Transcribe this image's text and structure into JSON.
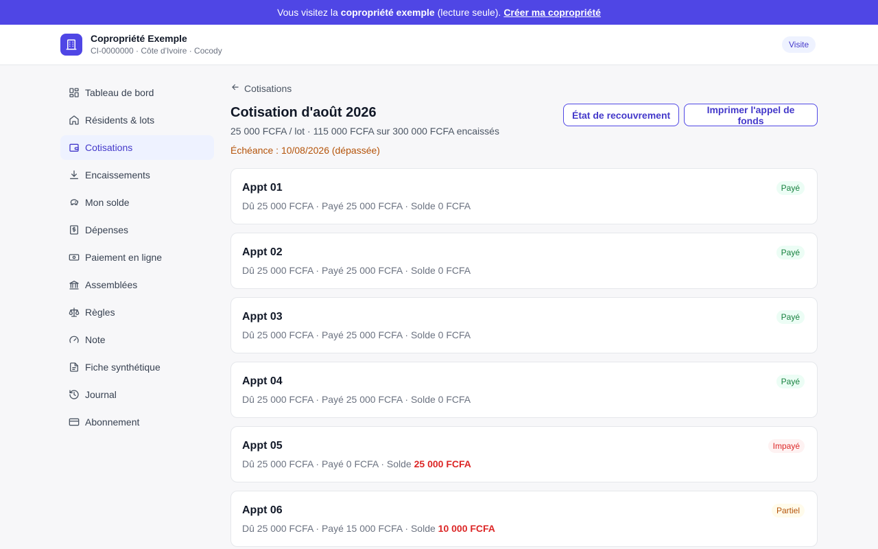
{
  "banner": {
    "prefix": "Vous visitez la",
    "highlight": "copropriété exemple",
    "suffix": "(lecture seule).",
    "cta": "Créer ma copropriété",
    "color": "#4f46e5"
  },
  "header": {
    "org_name": "Copropriété Exemple",
    "org_sub": "CI-0000000 · Côte d'Ivoire · Cocody",
    "badge": "Visite",
    "logo_icon": "building-icon"
  },
  "sidebar": {
    "items": [
      {
        "label": "Tableau de bord",
        "icon": "dashboard-icon",
        "active": false
      },
      {
        "label": "Résidents & lots",
        "icon": "home-icon",
        "active": false
      },
      {
        "label": "Cotisations",
        "icon": "wallet-icon",
        "active": true
      },
      {
        "label": "Encaissements",
        "icon": "download-icon",
        "active": false
      },
      {
        "label": "Mon solde",
        "icon": "piggy-bank-icon",
        "active": false
      },
      {
        "label": "Dépenses",
        "icon": "receipt-icon",
        "active": false
      },
      {
        "label": "Paiement en ligne",
        "icon": "banknote-icon",
        "active": false
      },
      {
        "label": "Assemblées",
        "icon": "landmark-icon",
        "active": false
      },
      {
        "label": "Règles",
        "icon": "scale-icon",
        "active": false
      },
      {
        "label": "Note",
        "icon": "gauge-icon",
        "active": false
      },
      {
        "label": "Fiche synthétique",
        "icon": "file-text-icon",
        "active": false
      },
      {
        "label": "Journal",
        "icon": "history-icon",
        "active": false
      },
      {
        "label": "Abonnement",
        "icon": "credit-card-icon",
        "active": false
      }
    ]
  },
  "main": {
    "back_label": "Cotisations",
    "title": "Cotisation d'août 2026",
    "subtitle": "25 000 FCFA / lot · 115 000 FCFA sur 300 000 FCFA encaissés",
    "due": "Échéance : 10/08/2026 (dépassée)",
    "buttons": {
      "recovery": "État de recouvrement",
      "print": "Imprimer l'appel de fonds"
    }
  },
  "lots": [
    {
      "name": "Appt 01",
      "due_text": "Dû 25 000 FCFA",
      "paid_text": "Payé 25 000 FCFA",
      "balance_label": "Solde",
      "balance": "0 FCFA",
      "owed": false,
      "status": "Payé",
      "status_kind": "paid"
    },
    {
      "name": "Appt 02",
      "due_text": "Dû 25 000 FCFA",
      "paid_text": "Payé 25 000 FCFA",
      "balance_label": "Solde",
      "balance": "0 FCFA",
      "owed": false,
      "status": "Payé",
      "status_kind": "paid"
    },
    {
      "name": "Appt 03",
      "due_text": "Dû 25 000 FCFA",
      "paid_text": "Payé 25 000 FCFA",
      "balance_label": "Solde",
      "balance": "0 FCFA",
      "owed": false,
      "status": "Payé",
      "status_kind": "paid"
    },
    {
      "name": "Appt 04",
      "due_text": "Dû 25 000 FCFA",
      "paid_text": "Payé 25 000 FCFA",
      "balance_label": "Solde",
      "balance": "0 FCFA",
      "owed": false,
      "status": "Payé",
      "status_kind": "paid"
    },
    {
      "name": "Appt 05",
      "due_text": "Dû 25 000 FCFA",
      "paid_text": "Payé 0 FCFA",
      "balance_label": "Solde",
      "balance": "25 000 FCFA",
      "owed": true,
      "status": "Impayé",
      "status_kind": "unpaid"
    },
    {
      "name": "Appt 06",
      "due_text": "Dû 25 000 FCFA",
      "paid_text": "Payé 15 000 FCFA",
      "balance_label": "Solde",
      "balance": "10 000 FCFA",
      "owed": true,
      "status": "Partiel",
      "status_kind": "partial"
    }
  ]
}
